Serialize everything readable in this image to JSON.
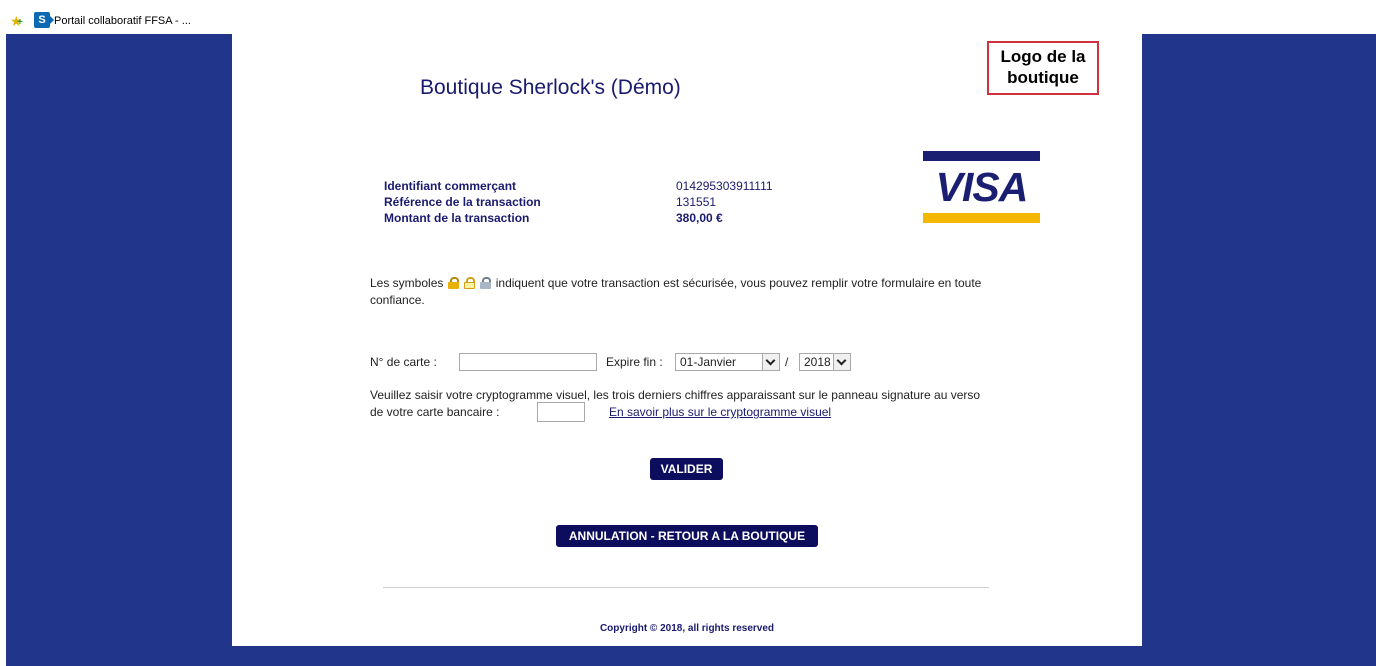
{
  "favorites": {
    "item_label": "Portail collaboratif FFSA - ..."
  },
  "colors": {
    "page_background": "#21358a",
    "title_color": "#1a1a6e",
    "button_bg": "#0d0d5e",
    "logo_border": "#d0313e",
    "visa_blue": "#1a1f71",
    "visa_gold": "#f5b800"
  },
  "shop": {
    "title": "Boutique Sherlock's (Démo)",
    "logo_line1": "Logo de la",
    "logo_line2": "boutique"
  },
  "card_brand": {
    "name": "VISA"
  },
  "transaction": {
    "merchant_label": "Identifiant commerçant",
    "merchant_value": "014295303911111",
    "reference_label": "Référence de la transaction",
    "reference_value": "131551",
    "amount_label": "Montant de la transaction",
    "amount_value": "380,00 €"
  },
  "security": {
    "text_before": "Les symboles",
    "text_after": "indiquent que votre transaction est sécurisée, vous pouvez remplir votre formulaire en toute confiance.",
    "icons": [
      "lock-gold-icon",
      "lock-open-yellow-icon",
      "lock-grey-icon"
    ]
  },
  "form": {
    "card_label": "N° de carte :",
    "card_value": "",
    "expiry_label": "Expire fin :",
    "month_value": "01-Janvier",
    "slash": "/",
    "year_value": "2018",
    "cvv_text": "Veuillez saisir votre cryptogramme visuel, les trois derniers chiffres apparaissant sur le panneau signature au verso",
    "cvv_label": "de votre carte bancaire :",
    "cvv_value": "",
    "cvv_link": "En savoir plus sur le cryptogramme visuel"
  },
  "buttons": {
    "validate": "VALIDER",
    "cancel": "ANNULATION - RETOUR A LA BOUTIQUE"
  },
  "footer": {
    "copyright": "Copyright © 2018, all rights reserved"
  }
}
